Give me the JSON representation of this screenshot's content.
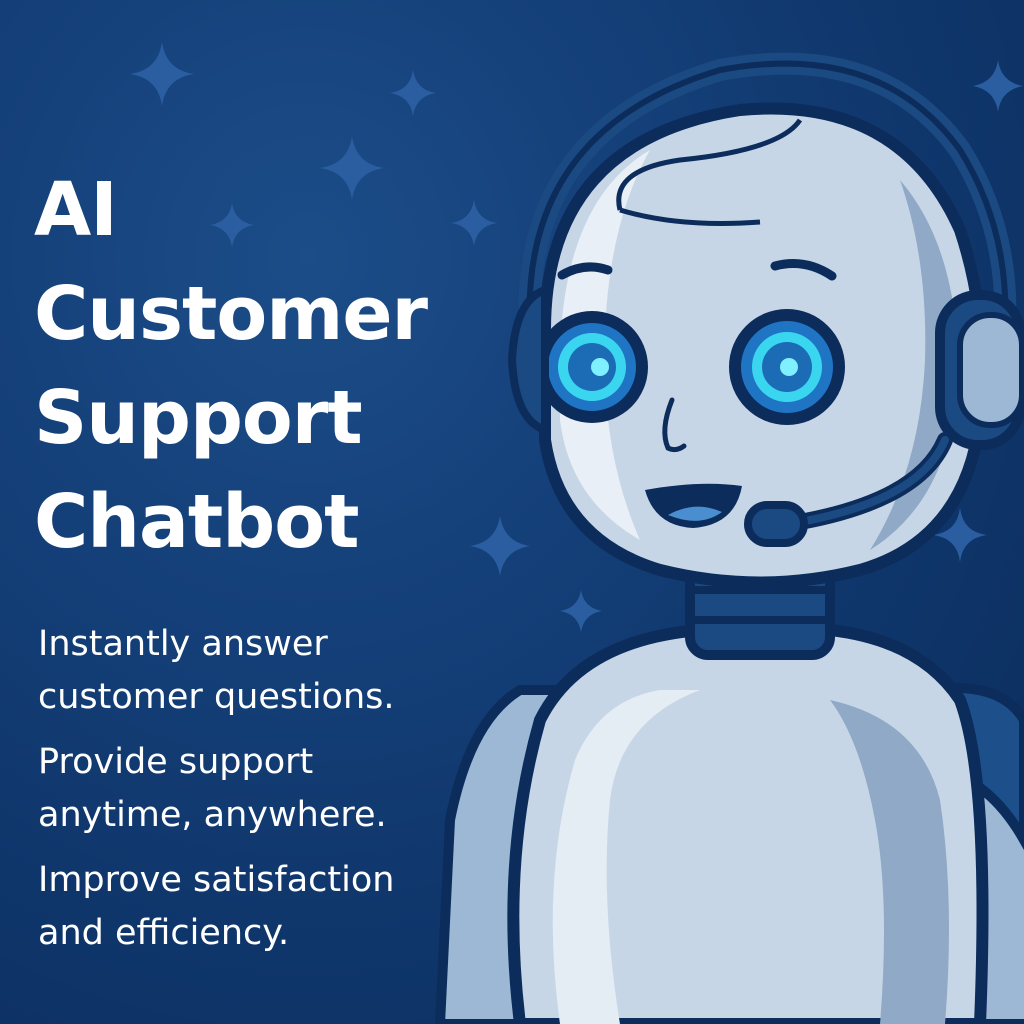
{
  "headline": {
    "line1": "AI",
    "line2": "Customer",
    "line3": "Support",
    "line4": "Chatbot"
  },
  "benefits": [
    "Instantly answer customer questions.",
    "Provide support anytime, anywhere.",
    "Improve satisfaction and efficiency."
  ],
  "colors": {
    "background": "#0f3366",
    "text": "#ffffff",
    "robot_body": "#c7d6e6",
    "robot_outline": "#0c2c5c",
    "eye_glow": "#3ad6f0"
  },
  "illustration": {
    "subject": "robot-with-headset",
    "decoration": "sparkle-stars"
  }
}
